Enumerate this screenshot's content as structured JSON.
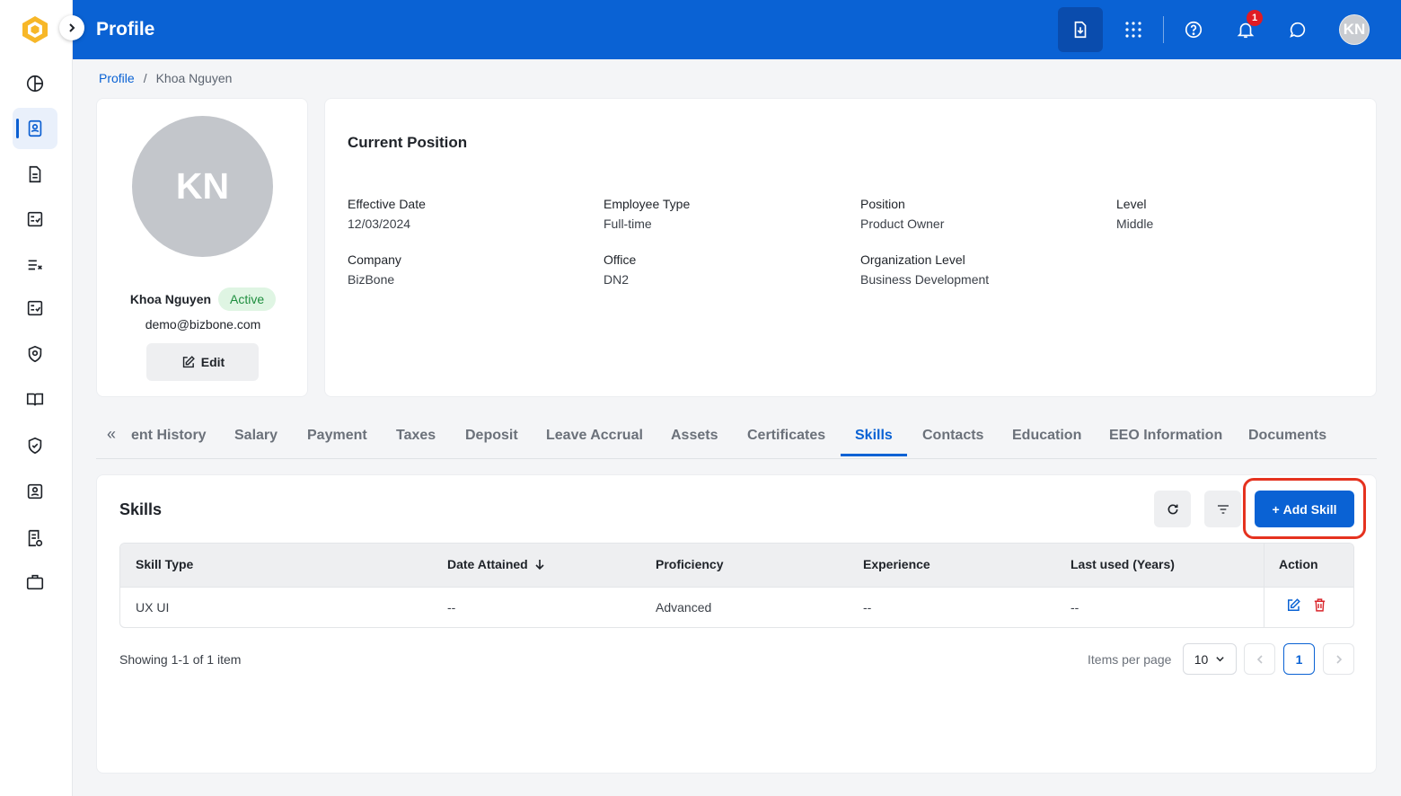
{
  "header": {
    "title": "Profile",
    "notification_count": "1",
    "user_initials": "KN"
  },
  "breadcrumb": {
    "root": "Profile",
    "separator": "/",
    "current": "Khoa Nguyen"
  },
  "profile": {
    "initials": "KN",
    "name": "Khoa Nguyen",
    "status": "Active",
    "email": "demo@bizbone.com",
    "edit_label": "Edit"
  },
  "position": {
    "title": "Current Position",
    "fields": [
      {
        "label": "Effective Date",
        "value": "12/03/2024"
      },
      {
        "label": "Employee Type",
        "value": "Full-time"
      },
      {
        "label": "Position",
        "value": "Product Owner"
      },
      {
        "label": "Level",
        "value": "Middle"
      },
      {
        "label": "Company",
        "value": "BizBone"
      },
      {
        "label": "Office",
        "value": "DN2"
      },
      {
        "label": "Organization Level",
        "value": "Business Development"
      }
    ]
  },
  "tabs": {
    "items": [
      "ent History",
      "Salary",
      "Payment",
      "Taxes",
      "Deposit",
      "Leave Accrual",
      "Assets",
      "Certificates",
      "Skills",
      "Contacts",
      "Education",
      "EEO Information",
      "Documents"
    ],
    "active": "Skills"
  },
  "skills": {
    "title": "Skills",
    "add_label": "Add Skill",
    "columns": [
      "Skill Type",
      "Date Attained",
      "Proficiency",
      "Experience",
      "Last used (Years)",
      "Action"
    ],
    "rows": [
      {
        "skill_type": "UX UI",
        "date_attained": "--",
        "proficiency": "Advanced",
        "experience": "--",
        "last_used": "--"
      }
    ],
    "showing": "Showing 1-1 of 1 item",
    "items_per_page_label": "Items per page",
    "items_per_page": "10",
    "current_page": "1"
  },
  "colors": {
    "primary": "#0a62d4",
    "header": "#0a62d4",
    "highlight": "#e5321f",
    "active_badge_bg": "#dff5e3",
    "active_badge_text": "#1e8e3e",
    "delete_icon": "#d9262c"
  }
}
